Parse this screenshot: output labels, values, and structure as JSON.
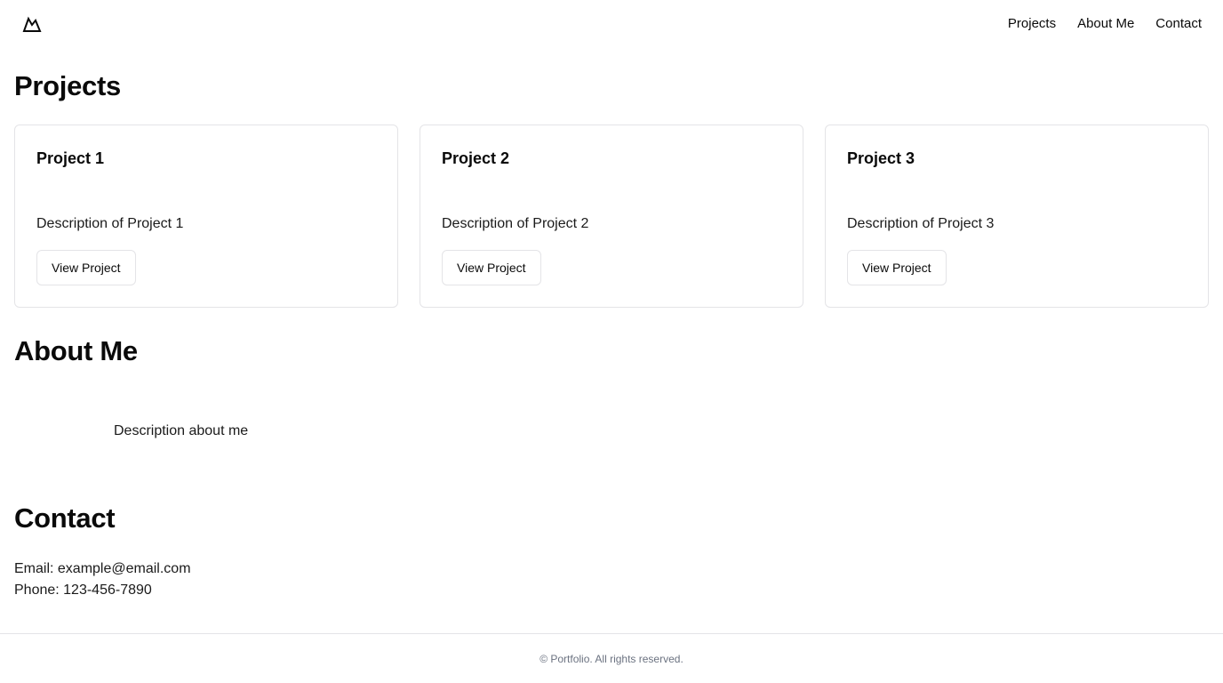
{
  "header": {
    "logo_icon": "mountain-icon",
    "nav": [
      "Projects",
      "About Me",
      "Contact"
    ]
  },
  "projects": {
    "title": "Projects",
    "items": [
      {
        "title": "Project 1",
        "description": "Description of Project 1",
        "button": "View Project"
      },
      {
        "title": "Project 2",
        "description": "Description of Project 2",
        "button": "View Project"
      },
      {
        "title": "Project 3",
        "description": "Description of Project 3",
        "button": "View Project"
      }
    ]
  },
  "about": {
    "title": "About Me",
    "description": "Description about me"
  },
  "contact": {
    "title": "Contact",
    "email": "Email: example@email.com",
    "phone": "Phone: 123-456-7890"
  },
  "footer": {
    "text": "© Portfolio. All rights reserved."
  }
}
